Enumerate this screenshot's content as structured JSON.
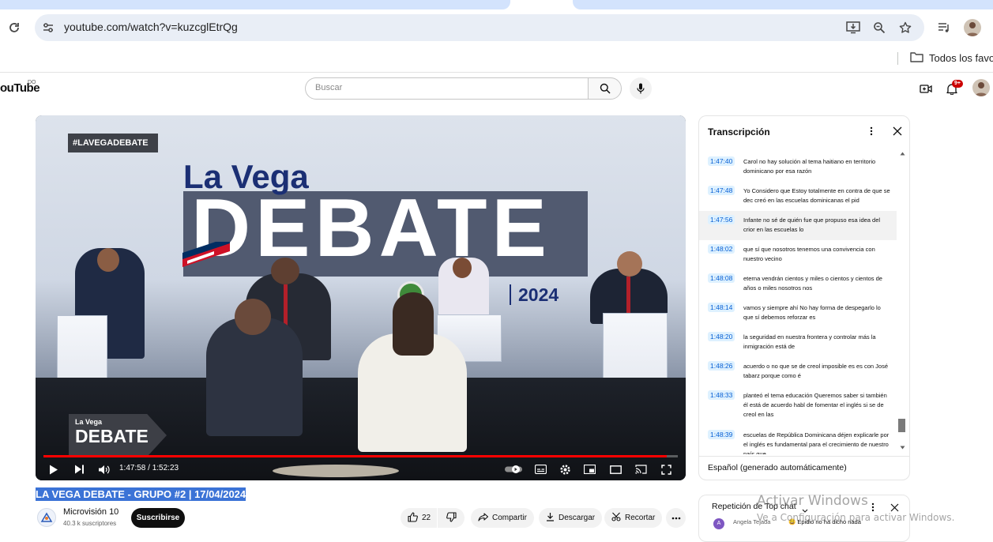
{
  "browser": {
    "url": "youtube.com/watch?v=kuzcglEtrQg",
    "bookmark_folder": "Todos los favor"
  },
  "youtube": {
    "logo_text": "ouTube",
    "logo_sup": "DO",
    "search_placeholder": "Buscar",
    "notifications_badge": "9+"
  },
  "video": {
    "overlay_hashtag": "#LAVEGADEBATE",
    "overlay_title_top": "La Vega",
    "overlay_title_main": "DEBATE",
    "overlay_year": "2024",
    "corner_logo_top": "La Vega",
    "corner_logo_main": "DEBATE",
    "progress_fraction": 0.982,
    "time_current": "1:47:58",
    "time_total": "1:52:23",
    "time_readout": "1:47:58 / 1:52:23",
    "title": "LA VEGA DEBATE - GRUPO #2 | 17/04/2024"
  },
  "channel": {
    "name": "Microvisión 10",
    "subscribers": "40.3 k suscriptores",
    "subscribe_label": "Suscribirse"
  },
  "actions": {
    "likes": "22",
    "share_label": "Compartir",
    "download_label": "Descargar",
    "clip_label": "Recortar"
  },
  "transcript": {
    "title": "Transcripción",
    "language": "Español (generado automáticamente)",
    "segments": [
      {
        "time": "1:47:40",
        "text": "Carol no hay solución al tema haitiano en territorio dominicano por esa razón"
      },
      {
        "time": "1:47:48",
        "text": "Yo Considero que Estoy totalmente en contra de que se dec creó en las escuelas dominicanas el pid"
      },
      {
        "time": "1:47:56",
        "text": "Infante no sé de quién fue que propuso esa idea del crior en las escuelas lo"
      },
      {
        "time": "1:48:02",
        "text": "que sí que nosotros tenemos una convivencia con nuestro vecino"
      },
      {
        "time": "1:48:08",
        "text": "eterna vendrán cientos y miles o cientos y cientos de años o miles nosotros nos"
      },
      {
        "time": "1:48:14",
        "text": "vamos y siempre ahí No hay forma de despegarlo lo que sí debemos reforzar es"
      },
      {
        "time": "1:48:20",
        "text": "la seguridad en nuestra frontera y controlar más la inmigración está de"
      },
      {
        "time": "1:48:26",
        "text": "acuerdo o no que se de creol imposible es es con José tabarz porque como é"
      },
      {
        "time": "1:48:33",
        "text": "planteó el tema educación Queremos saber si también él está de acuerdo habl de fomentar el inglés si se de creol en las"
      },
      {
        "time": "1:48:39",
        "text": "escuelas de República Dominicana déjen explicarle por el inglés es fundamental para el crecimiento de nuestro país que"
      }
    ],
    "active_index": 2
  },
  "chat": {
    "title": "Repetición de Top chat",
    "author": "Angela Tejada",
    "message": "😄 Epidio no ha dicho nada",
    "avatar_letter": "A"
  },
  "watermark": {
    "title": "Activar Windows",
    "subtitle": "Ve a Configuración para activar Windows."
  }
}
